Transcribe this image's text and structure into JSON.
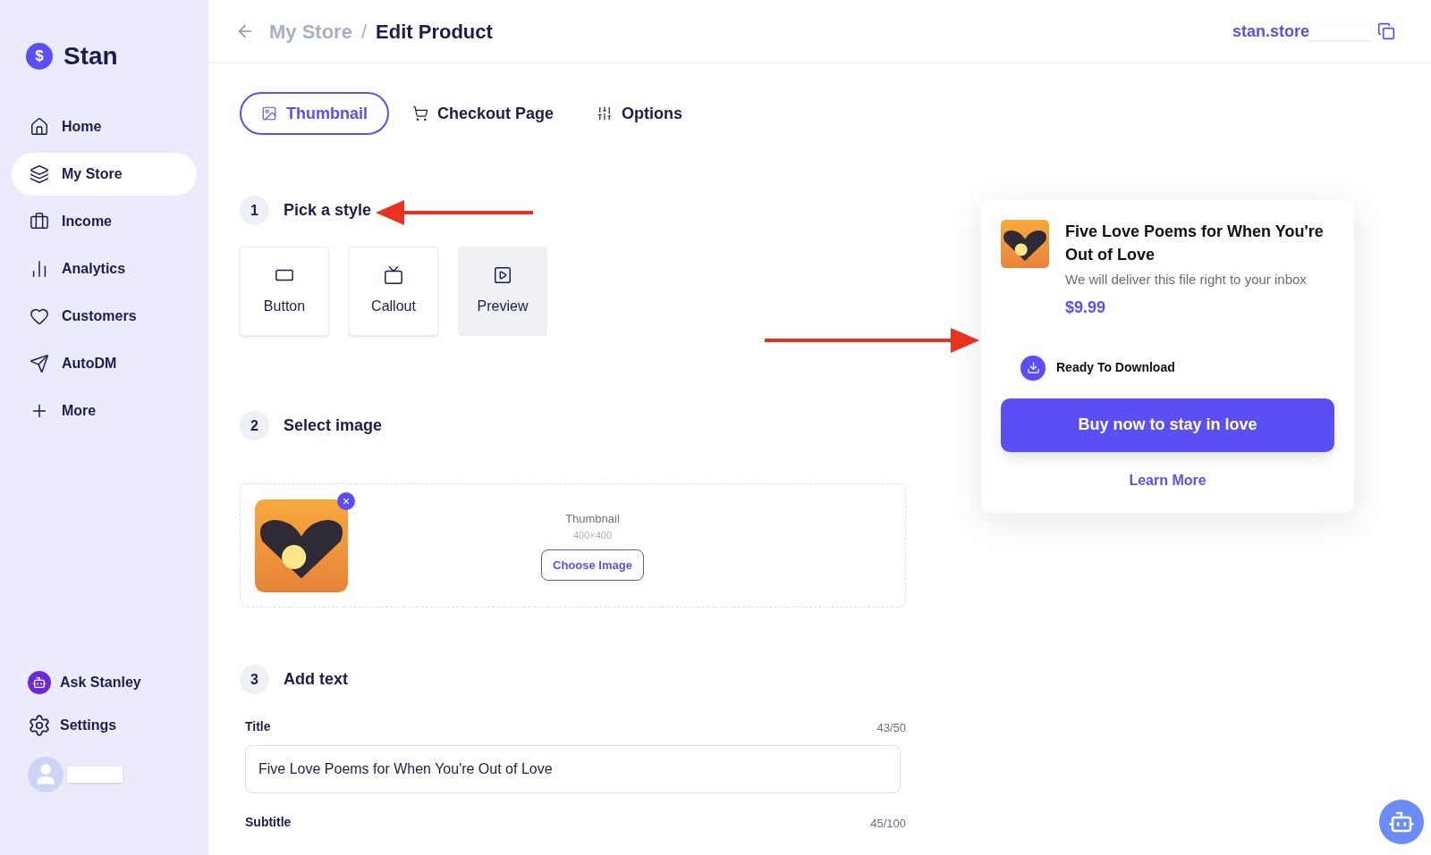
{
  "sidebar": {
    "brand": "Stan",
    "brand_icon": "$",
    "items": [
      {
        "label": "Home",
        "selected": false
      },
      {
        "label": "My Store",
        "selected": true
      },
      {
        "label": "Income",
        "selected": false
      },
      {
        "label": "Analytics",
        "selected": false
      },
      {
        "label": "Customers",
        "selected": false
      },
      {
        "label": "AutoDM",
        "selected": false
      },
      {
        "label": "More",
        "selected": false
      }
    ],
    "bottom_items": [
      {
        "label": "Ask Stanley"
      },
      {
        "label": "Settings"
      }
    ]
  },
  "header": {
    "breadcrumb": [
      "My Store",
      "Edit Product"
    ],
    "separator": "/",
    "store_link": "stan.store"
  },
  "tabs": [
    {
      "label": "Thumbnail",
      "selected": true
    },
    {
      "label": "Checkout Page",
      "selected": false
    },
    {
      "label": "Options",
      "selected": false
    }
  ],
  "steps": [
    {
      "number": "1",
      "title": "Pick a style"
    },
    {
      "number": "2",
      "title": "Select image"
    },
    {
      "number": "3",
      "title": "Add text"
    }
  ],
  "styles": [
    {
      "label": "Button",
      "selected": false
    },
    {
      "label": "Callout",
      "selected": false
    },
    {
      "label": "Preview",
      "selected": true
    }
  ],
  "image": {
    "label": "Thumbnail",
    "size": "400×400",
    "button": "Choose Image",
    "remove": "×"
  },
  "fields": [
    {
      "label": "Title",
      "count": "43/50",
      "value": "Five Love Poems for When You're Out of Love"
    },
    {
      "label": "Subtitle",
      "count": "45/100"
    }
  ],
  "preview": {
    "title": "Five Love Poems for When You're Out of Love",
    "subtitle": "We will deliver this file right to your inbox",
    "price": "$9.99",
    "badge": "Ready To Download",
    "button": "Buy now to stay in love",
    "link": "Learn More"
  }
}
